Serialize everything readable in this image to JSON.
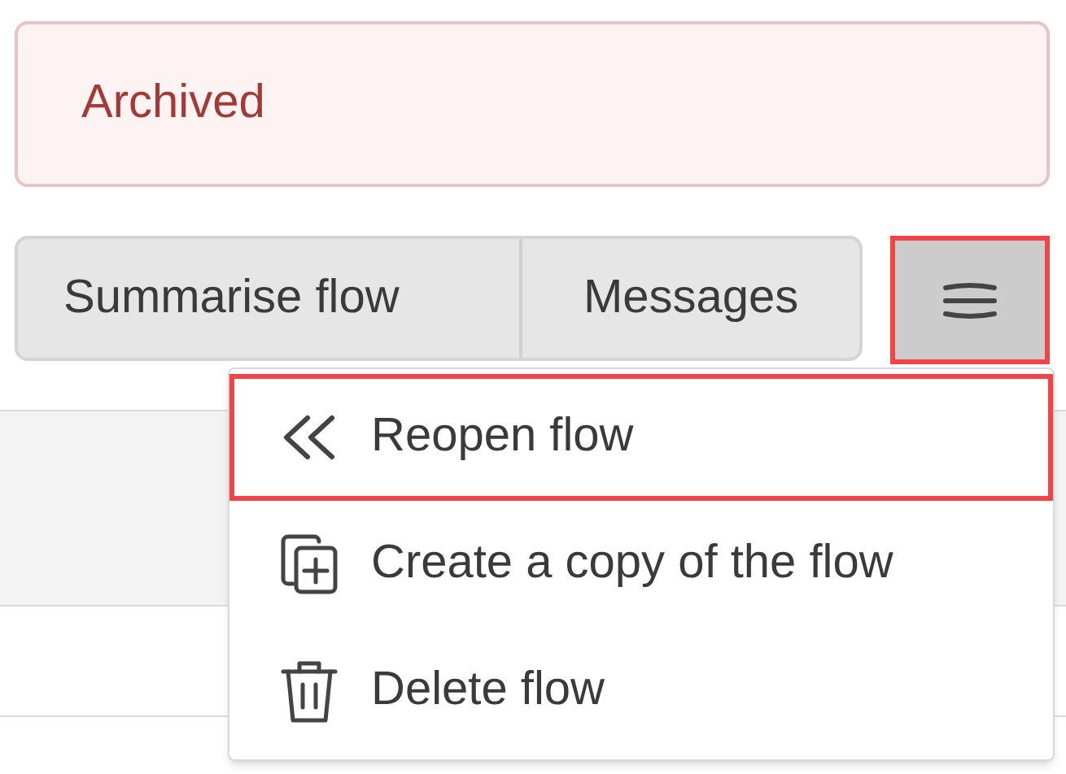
{
  "status_banner": {
    "text": "Archived"
  },
  "button_group": [
    {
      "label": "Summarise flow"
    },
    {
      "label": "Messages"
    }
  ],
  "menu_button": {
    "highlighted": true,
    "expanded": true
  },
  "menu": [
    {
      "kind": "reopen",
      "label": "Reopen flow",
      "highlighted": true
    },
    {
      "kind": "copy",
      "label": "Create a copy of the flow",
      "highlighted": false
    },
    {
      "kind": "delete",
      "label": "Delete flow",
      "highlighted": false
    }
  ]
}
